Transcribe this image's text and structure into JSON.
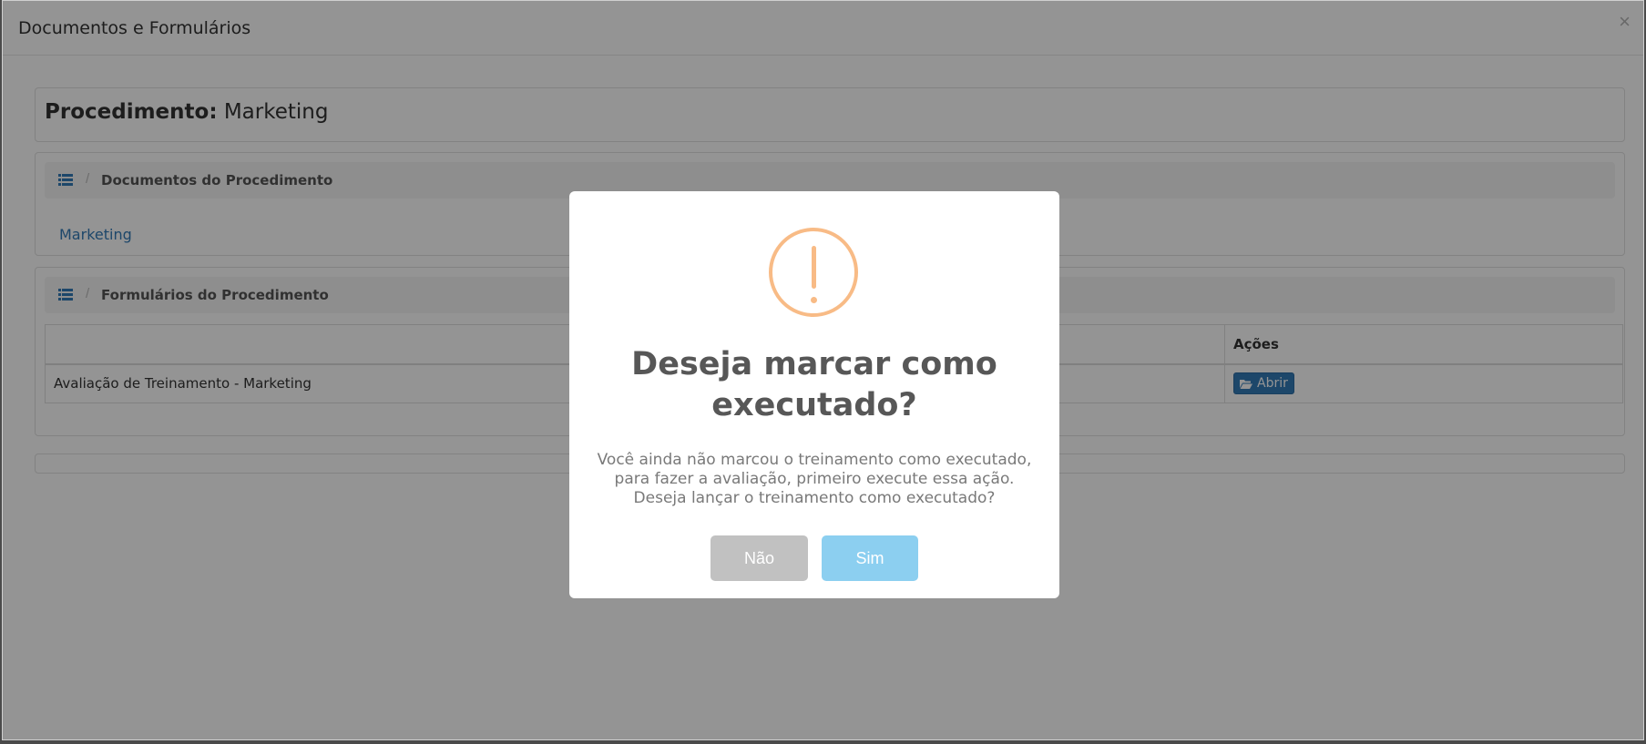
{
  "window": {
    "title": "Documentos e Formulários",
    "close_glyph": "×"
  },
  "procedure": {
    "label": "Procedimento:",
    "name": "Marketing"
  },
  "documents": {
    "section_title": "Documentos do Procedimento",
    "separator": "/",
    "items": [
      "Marketing"
    ]
  },
  "forms": {
    "section_title": "Formulários do Procedimento",
    "separator": "/",
    "columns": [
      "",
      "Ações"
    ],
    "rows": [
      {
        "name": "Avaliação de Treinamento - Marketing",
        "action_label": "Abrir"
      }
    ]
  },
  "dialog": {
    "icon": "warning-icon",
    "title": "Deseja marcar como executado?",
    "text_lines": [
      "Você ainda não marcou o treinamento como executado,",
      "para fazer a avaliação, primeiro execute essa ação.",
      "Deseja lançar o treinamento como executado?"
    ],
    "cancel_label": "Não",
    "confirm_label": "Sim"
  },
  "colors": {
    "warning": "#f8bb86",
    "confirm": "#8ccff0",
    "cancel": "#c1c1c1",
    "link": "#337ab7"
  }
}
